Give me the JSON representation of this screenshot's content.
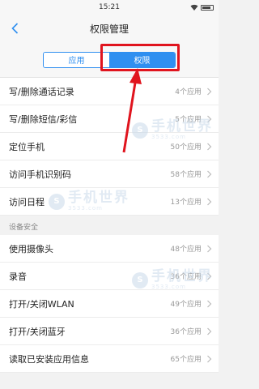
{
  "status": {
    "time": "15:21"
  },
  "nav": {
    "title": "权限管理"
  },
  "segment": {
    "tab_apps": "应用",
    "tab_perms": "权限"
  },
  "rows_top": [
    {
      "label": "写/删除通话记录",
      "count": "4个应用"
    },
    {
      "label": "写/删除短信/彩信",
      "count": "5个应用"
    },
    {
      "label": "定位手机",
      "count": "50个应用"
    },
    {
      "label": "访问手机识别码",
      "count": "58个应用"
    },
    {
      "label": "访问日程",
      "count": "13个应用"
    }
  ],
  "section": {
    "title": "设备安全"
  },
  "rows_bottom": [
    {
      "label": "使用摄像头",
      "count": "48个应用"
    },
    {
      "label": "录音",
      "count": "36个应用"
    },
    {
      "label": "打开/关闭WLAN",
      "count": "49个应用"
    },
    {
      "label": "打开/关闭蓝牙",
      "count": "36个应用"
    },
    {
      "label": "读取已安装应用信息",
      "count": "65个应用"
    }
  ],
  "watermark": {
    "text": "手机世界",
    "sub": "3533.com",
    "logo": "S"
  },
  "colors": {
    "accent": "#2f8ff0",
    "highlight": "#e0141e"
  }
}
